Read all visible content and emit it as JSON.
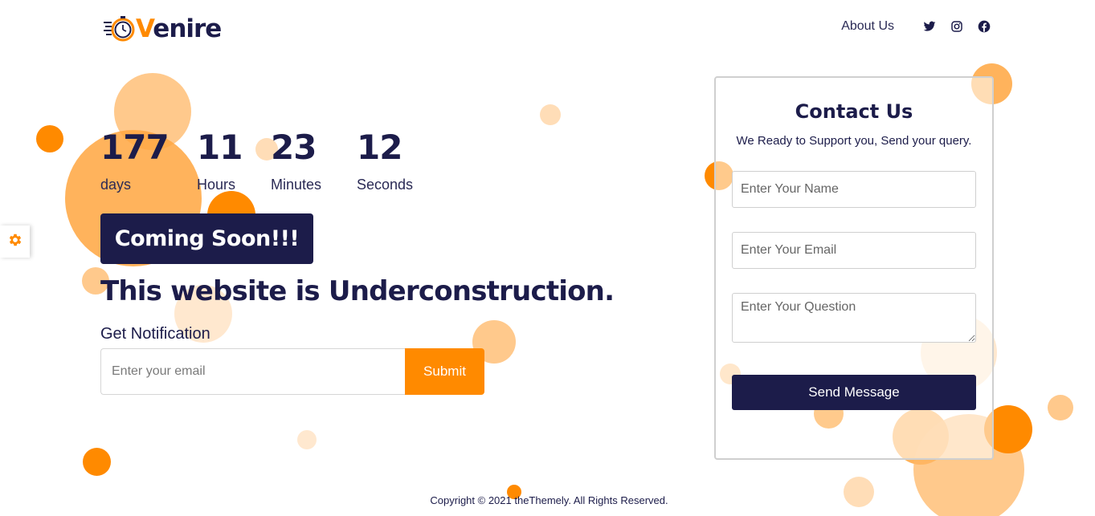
{
  "brand": {
    "name_accent": "V",
    "name_rest": "enire",
    "icon": "stopwatch-logo-icon"
  },
  "nav": {
    "about_label": "About Us",
    "social": [
      {
        "icon": "twitter-icon"
      },
      {
        "icon": "instagram-icon"
      },
      {
        "icon": "facebook-icon"
      }
    ]
  },
  "countdown": {
    "days": {
      "value": "177",
      "label": "days"
    },
    "hours": {
      "value": "11",
      "label": "Hours"
    },
    "minutes": {
      "value": "23",
      "label": "Minutes"
    },
    "seconds": {
      "value": "12",
      "label": "Seconds"
    }
  },
  "hero": {
    "badge": "Coming Soon!!!",
    "headline": "This website is Underconstruction."
  },
  "notification": {
    "label": "Get Notification",
    "email_placeholder": "Enter your email",
    "submit_label": "Submit"
  },
  "contact": {
    "title": "Contact Us",
    "subtitle": "We Ready to Support you, Send your query.",
    "name_placeholder": "Enter Your Name",
    "email_placeholder": "Enter Your Email",
    "question_placeholder": "Enter Your Question",
    "send_label": "Send Message"
  },
  "settings": {
    "icon": "gear-icon"
  },
  "footer": {
    "copyright": "Copyright © 2021 theThemely. All Rights Reserved."
  },
  "colors": {
    "accent": "#ff8a00",
    "brand_dark": "#1c1c4a",
    "background": "#ffffff"
  }
}
